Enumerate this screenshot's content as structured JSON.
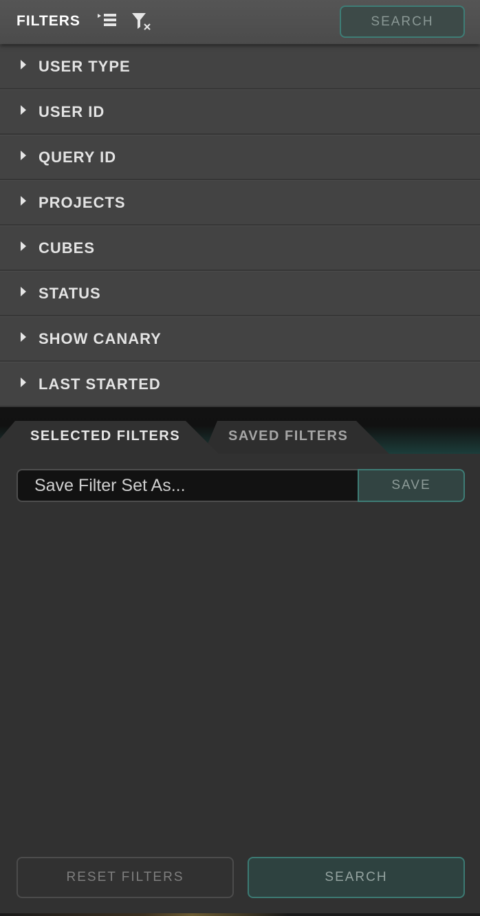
{
  "header": {
    "title": "FILTERS",
    "search_label": "SEARCH"
  },
  "filters": [
    {
      "label": "USER TYPE"
    },
    {
      "label": "USER ID"
    },
    {
      "label": "QUERY ID"
    },
    {
      "label": "PROJECTS"
    },
    {
      "label": "CUBES"
    },
    {
      "label": "STATUS"
    },
    {
      "label": "SHOW CANARY"
    },
    {
      "label": "LAST STARTED"
    }
  ],
  "tabs": {
    "selected_label": "SELECTED FILTERS",
    "saved_label": "SAVED FILTERS"
  },
  "save_form": {
    "placeholder": "Save Filter Set As...",
    "value": "",
    "save_label": "SAVE"
  },
  "footer": {
    "reset_label": "RESET FILTERS",
    "search_label": "SEARCH"
  },
  "colors": {
    "accent_border": "#3e7d76",
    "header_bg": "#4f4f4f",
    "row_bg": "#434343",
    "panel_bg": "#313131"
  },
  "icons": {
    "expand": "expand-list-icon",
    "clear_filter": "clear-filter-icon",
    "row_caret": "caret-right-icon"
  }
}
